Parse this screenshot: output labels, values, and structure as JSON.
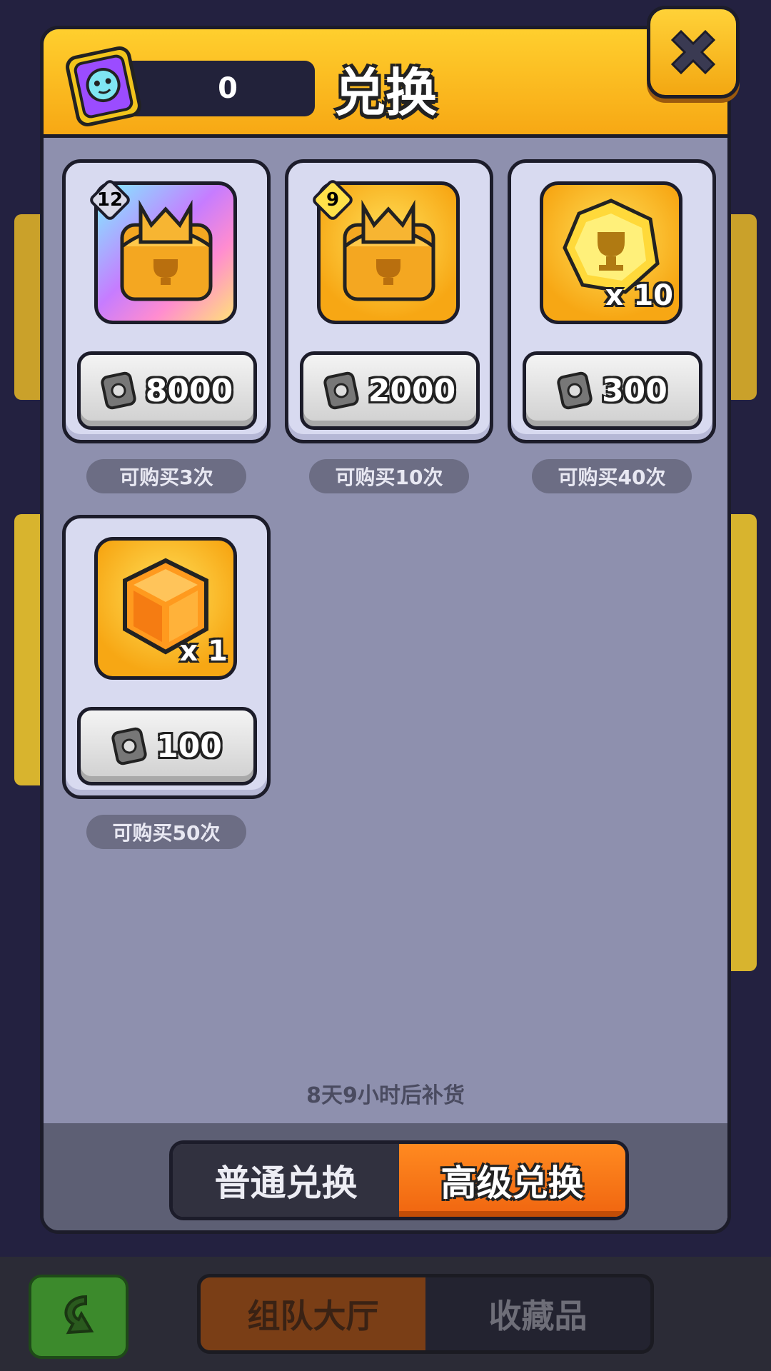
{
  "header": {
    "title": "兑换",
    "currency_value": "0",
    "currency_icon": "ticket-icon"
  },
  "close_icon": "close-icon",
  "items": [
    {
      "level": "12",
      "icon": "trophy-chest-icon",
      "frame": "rainbow",
      "price": "8000",
      "limit": "可购买3次"
    },
    {
      "level": "9",
      "icon": "trophy-chest-icon",
      "frame": "gold",
      "price": "2000",
      "limit": "可购买10次"
    },
    {
      "quantity": "x 10",
      "icon": "trophy-token-icon",
      "frame": "gold",
      "price": "300",
      "limit": "可购买40次"
    },
    {
      "quantity": "x 1",
      "icon": "gem-cube-icon",
      "frame": "gold",
      "price": "100",
      "limit": "可购买50次"
    }
  ],
  "restock_text": "8天9小时后补货",
  "tabs": {
    "normal": "普通兑换",
    "advanced": "高级兑换",
    "active": "advanced"
  },
  "bottom_nav": {
    "back_icon": "return-arrow-icon",
    "team_hall": "组队大厅",
    "collection": "收藏品"
  },
  "colors": {
    "header_gold": "#ffc21f",
    "accent_orange": "#f57616",
    "panel": "#8e90ae",
    "card": "#d8daf0"
  }
}
